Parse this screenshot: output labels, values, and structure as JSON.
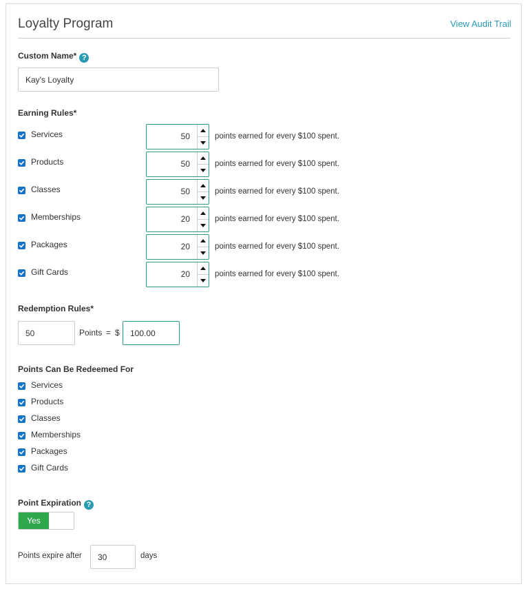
{
  "header": {
    "title": "Loyalty Program",
    "audit_link": "View Audit Trail"
  },
  "custom_name": {
    "label": "Custom Name*",
    "value": "Kay's Loyalty"
  },
  "earning": {
    "label": "Earning Rules*",
    "suffix": "points earned for every $100 spent.",
    "rules": [
      {
        "label": "Services",
        "value": "50"
      },
      {
        "label": "Products",
        "value": "50"
      },
      {
        "label": "Classes",
        "value": "50"
      },
      {
        "label": "Memberships",
        "value": "20"
      },
      {
        "label": "Packages",
        "value": "20"
      },
      {
        "label": "Gift Cards",
        "value": "20"
      }
    ]
  },
  "redemption": {
    "label": "Redemption Rules*",
    "points_value": "50",
    "points_text": "Points",
    "equals": "=",
    "currency": "$",
    "dollar_value": "100.00"
  },
  "redeem_for": {
    "label": "Points Can Be Redeemed For",
    "items": [
      "Services",
      "Products",
      "Classes",
      "Memberships",
      "Packages",
      "Gift Cards"
    ]
  },
  "expiration": {
    "label": "Point Expiration",
    "toggle_on": "Yes",
    "prefix": "Points expire after",
    "days_value": "30",
    "suffix": "days"
  },
  "colors": {
    "accent": "#2a9bb3",
    "checkbox": "#1473c7",
    "toggle_on": "#2ea84b",
    "stepper_border": "#2e9b88"
  }
}
